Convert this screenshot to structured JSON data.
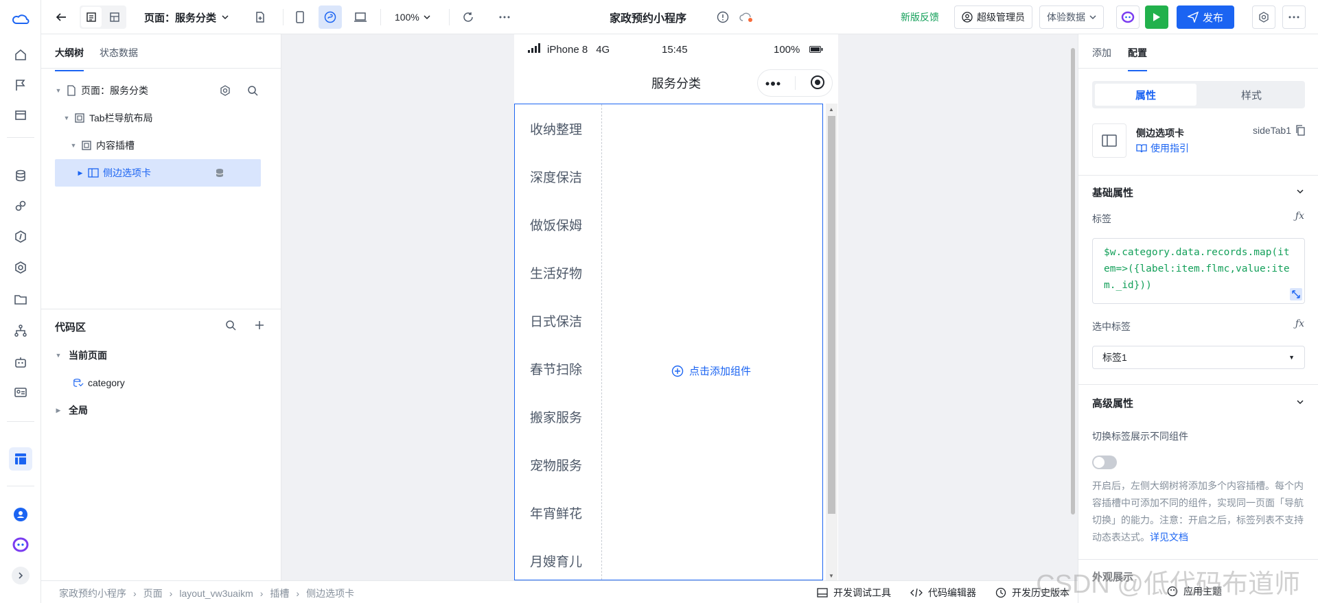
{
  "app": {
    "title": "家政预约小程序",
    "page_selector": "页面：服务分类",
    "zoom": "100%"
  },
  "toolbar": {
    "feedback": "新版反馈",
    "admin": "超级管理员",
    "data_mode": "体验数据",
    "publish": "发布"
  },
  "left_panel": {
    "tabs": [
      "大纲树",
      "状态数据"
    ],
    "tree": {
      "page": "页面：服务分类",
      "tab_layout": "Tab栏导航布局",
      "slot": "内容插槽",
      "side_tab": "侧边选项卡"
    },
    "code": {
      "title": "代码区",
      "current_page": "当前页面",
      "item": "category",
      "global": "全局"
    }
  },
  "phone": {
    "device": "iPhone 8",
    "network": "4G",
    "time": "15:45",
    "battery": "100%",
    "nav_title": "服务分类",
    "tabs": [
      "收纳整理",
      "深度保洁",
      "做饭保姆",
      "生活好物",
      "日式保洁",
      "春节扫除",
      "搬家服务",
      "宠物服务",
      "年宵鲜花",
      "月嫂育儿"
    ],
    "add_component": "点击添加组件"
  },
  "right_panel": {
    "tabs": [
      "添加",
      "配置"
    ],
    "segments": [
      "属性",
      "样式"
    ],
    "component": {
      "name": "侧边选项卡",
      "id": "sideTab1",
      "guide": "使用指引"
    },
    "basic": {
      "title": "基础属性",
      "label_field": "标签",
      "label_code": "$w.category.data.records.map(item=>({label:item.flmc,value:item._id}))",
      "selected_field": "选中标签",
      "selected_value": "标签1"
    },
    "advanced": {
      "title": "高级属性",
      "switch_label": "切换标签展示不同组件",
      "help": "开启后，左侧大纲树将添加多个内容插槽。每个内容插槽中可添加不同的组件，实现同一页面「导航切换」的能力。注意：开启之后，标签列表不支持动态表达式。",
      "help_link": "详见文档",
      "more": "外观展示"
    },
    "fx": "ƒx"
  },
  "bottom": {
    "breadcrumb": [
      "家政预约小程序",
      "页面",
      "layout_vw3uaikm",
      "插槽",
      "侧边选项卡"
    ],
    "tools": [
      "开发调试工具",
      "代码编辑器",
      "开发历史版本",
      "应用主题"
    ]
  },
  "watermark": "CSDN @低代码布道师",
  "colors": {
    "primary": "#1b64f2",
    "success": "#22b14c",
    "code": "#14a05a"
  }
}
